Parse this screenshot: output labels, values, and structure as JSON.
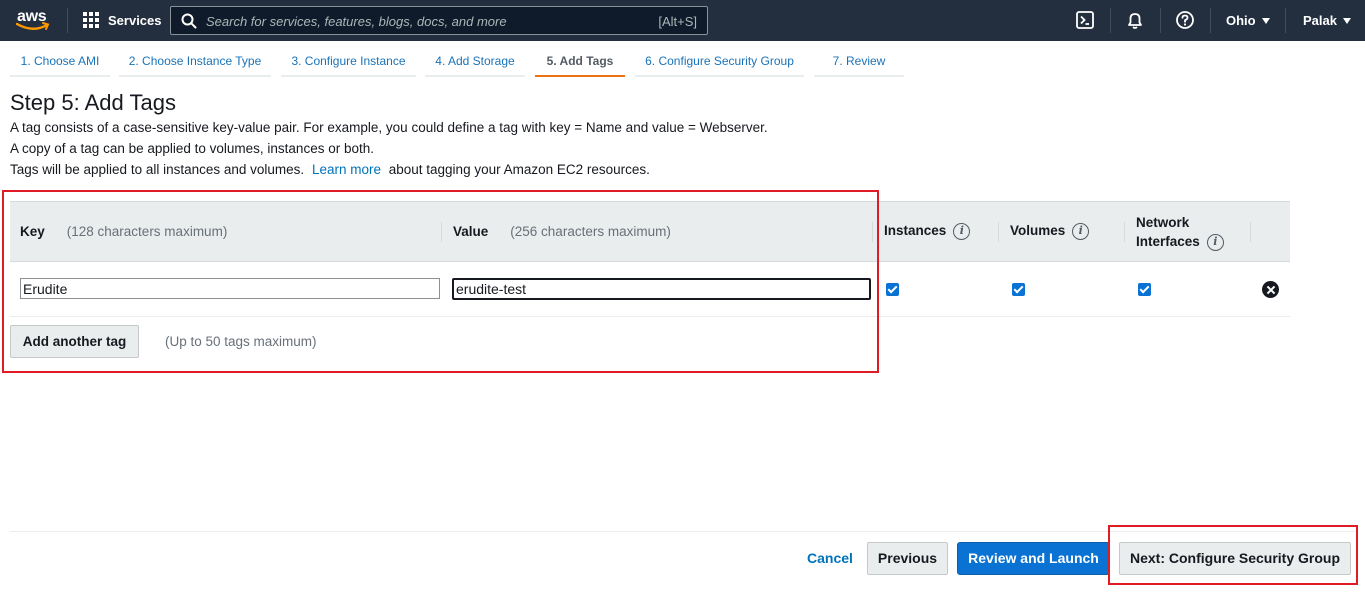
{
  "topnav": {
    "logo_text": "aws",
    "services_label": "Services",
    "search_placeholder": "Search for services, features, blogs, docs, and more",
    "search_shortcut": "[Alt+S]",
    "region": "Ohio",
    "user": "Palak",
    "icons": [
      "cloudshell-icon",
      "bell-icon",
      "help-icon"
    ]
  },
  "wizard": {
    "steps": [
      {
        "label": "1. Choose AMI"
      },
      {
        "label": "2. Choose Instance Type"
      },
      {
        "label": "3. Configure Instance"
      },
      {
        "label": "4. Add Storage"
      },
      {
        "label": "5. Add Tags"
      },
      {
        "label": "6. Configure Security Group"
      },
      {
        "label": "7. Review"
      }
    ],
    "active_step": "5. Add Tags"
  },
  "page": {
    "title": "Step 5: Add Tags",
    "desc1": "A tag consists of a case-sensitive key-value pair. For example, you could define a tag with key = Name and value = Webserver.",
    "desc2": "A copy of a tag can be applied to volumes, instances or both.",
    "desc3_pre": "Tags will be applied to all instances and volumes.",
    "desc3_link": "Learn more",
    "desc3_post": "about tagging your Amazon EC2 resources."
  },
  "table": {
    "headers": {
      "key": "Key",
      "key_hint": "(128 characters maximum)",
      "value": "Value",
      "value_hint": "(256 characters maximum)",
      "instances": "Instances",
      "volumes": "Volumes",
      "network_line1": "Network",
      "network_line2": "Interfaces",
      "info_glyph": "i"
    },
    "rows": [
      {
        "key": "Erudite",
        "value": "erudite-test",
        "instances": true,
        "volumes": true,
        "network_interfaces": true
      }
    ]
  },
  "add_tag": {
    "button_label": "Add another tag",
    "note": "(Up to 50 tags maximum)"
  },
  "footer": {
    "cancel": "Cancel",
    "previous": "Previous",
    "review_launch": "Review and Launch",
    "next": "Next: Configure Security Group"
  },
  "colors": {
    "nav_bg": "#232f3e",
    "link": "#0073bb",
    "primary": "#0972d3",
    "active_tab": "#ec7211",
    "highlight": "#e01b24"
  }
}
